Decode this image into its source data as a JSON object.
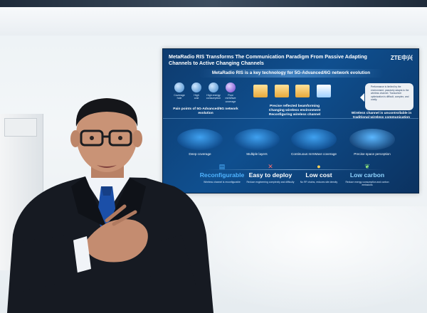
{
  "screen": {
    "title": "MetaRadio RIS Transforms The Communication Paradigm From Passive Adapting Channels to Active Changing Channels",
    "logo": "ZTE中兴",
    "banner": "MetaRadio RIS is a key technology for 5G-Advanced/6G network evolution",
    "pain_points": [
      {
        "label": "Coverage\nhole"
      },
      {
        "label": "High\ncost"
      },
      {
        "label": "High energy\nconsumption"
      },
      {
        "label": "Poor mmWave\ncoverage"
      }
    ],
    "pain_caption": "Pain points of 5G-Advanced/6G network evolution",
    "middle_caption_lines": [
      "Precise reflected beamforming",
      "Changing wireless environment",
      "Reconfiguring wireless channel"
    ],
    "right_card_text": "Performance is limited by the environment, passively adapts to the wireless channel. Transceiver optimization is difficult, complex, and costly.",
    "right_caption": "Wireless channel is uncontrollable in traditional wireless communication",
    "scenarios": [
      {
        "label": "Deep coverage"
      },
      {
        "label": "Multiple layers"
      },
      {
        "label": "Continuous mmWave coverage"
      },
      {
        "label": "Precise space perception"
      }
    ],
    "benefits": [
      {
        "title": "Reconfigurable",
        "desc": "Wireless channel is reconfigurable",
        "color": "#4fb3ff"
      },
      {
        "title": "Easy to deploy",
        "desc": "Reduce engineering complexity and difficulty",
        "color": "#ffffff"
      },
      {
        "title": "Low cost",
        "desc": "No RF chains, reduces site density",
        "color": "#ffffff"
      },
      {
        "title": "Low carbon",
        "desc": "Reduce energy consumption and carbon emissions",
        "color": "#8fd4ff"
      }
    ]
  },
  "colors": {
    "screen_bg": "#0f4f8f",
    "suit": "#161a22",
    "shirt": "#f1f4f8",
    "tie": "#1b4fa8",
    "skin": "#c99376"
  }
}
